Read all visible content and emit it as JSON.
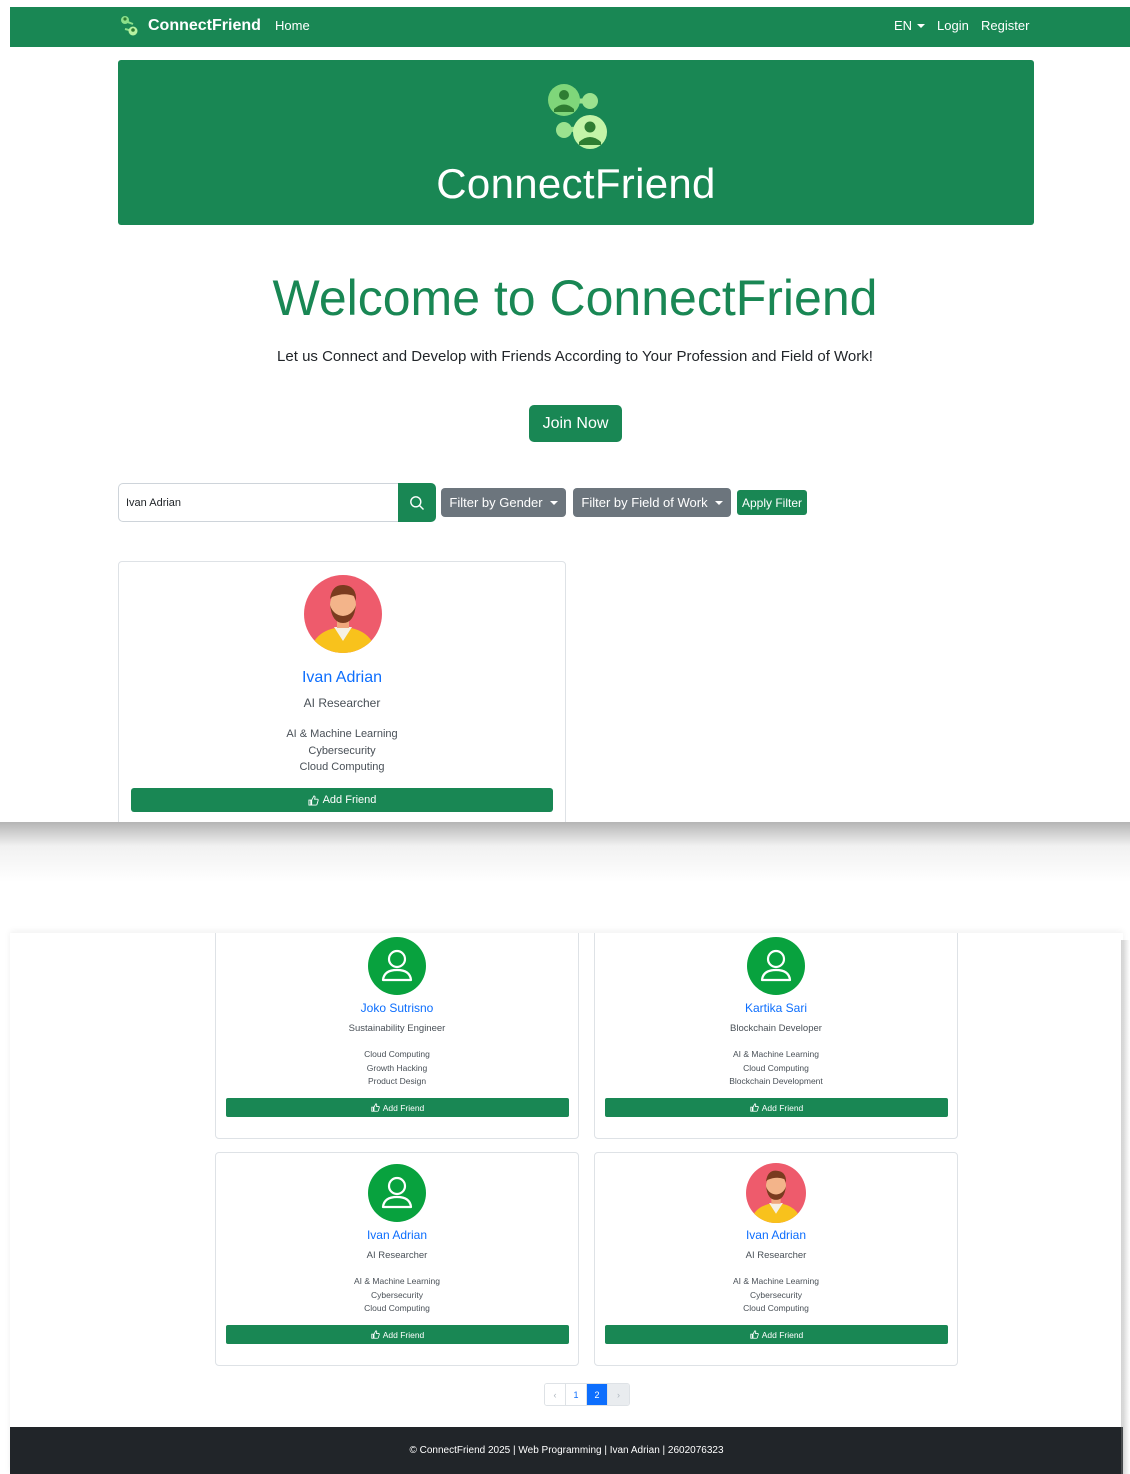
{
  "navbar": {
    "brand": "ConnectFriend",
    "home": "Home",
    "lang": "EN",
    "login": "Login",
    "register": "Register"
  },
  "hero": {
    "title": "ConnectFriend"
  },
  "welcome": {
    "heading": "Welcome to ConnectFriend",
    "tagline": "Let us Connect and Develop with Friends According to Your Profession and Field of Work!",
    "join_label": "Join Now"
  },
  "search": {
    "value": "Ivan Adrian",
    "filter_gender": "Filter by Gender",
    "filter_field": "Filter by Field of Work",
    "apply": "Apply Filter"
  },
  "add_friend_label": "Add Friend",
  "top_card": {
    "name": "Ivan Adrian",
    "job": "AI Researcher",
    "fields": [
      "AI & Machine Learning",
      "Cybersecurity",
      "Cloud Computing"
    ],
    "avatar": "photo"
  },
  "cards": [
    {
      "name": "Joko Sutrisno",
      "job": "Sustainability Engineer",
      "fields": [
        "Cloud Computing",
        "Growth Hacking",
        "Product Design"
      ],
      "avatar": "user-icon"
    },
    {
      "name": "Kartika Sari",
      "job": "Blockchain Developer",
      "fields": [
        "AI & Machine Learning",
        "Cloud Computing",
        "Blockchain Development"
      ],
      "avatar": "user-icon"
    },
    {
      "name": "Ivan Adrian",
      "job": "AI Researcher",
      "fields": [
        "AI & Machine Learning",
        "Cybersecurity",
        "Cloud Computing"
      ],
      "avatar": "user-icon"
    },
    {
      "name": "Ivan Adrian",
      "job": "AI Researcher",
      "fields": [
        "AI & Machine Learning",
        "Cybersecurity",
        "Cloud Computing"
      ],
      "avatar": "photo"
    }
  ],
  "pagination": {
    "prev": "‹",
    "pages": [
      "1",
      "2"
    ],
    "active": "2",
    "next": "›"
  },
  "footer": {
    "text": "© ConnectFriend 2025 | Web Programming | Ivan Adrian | 2602076323"
  },
  "colors": {
    "primary_green": "#198754",
    "link_blue": "#0d6efd",
    "secondary_gray": "#6c757d",
    "footer_dark": "#212529"
  }
}
